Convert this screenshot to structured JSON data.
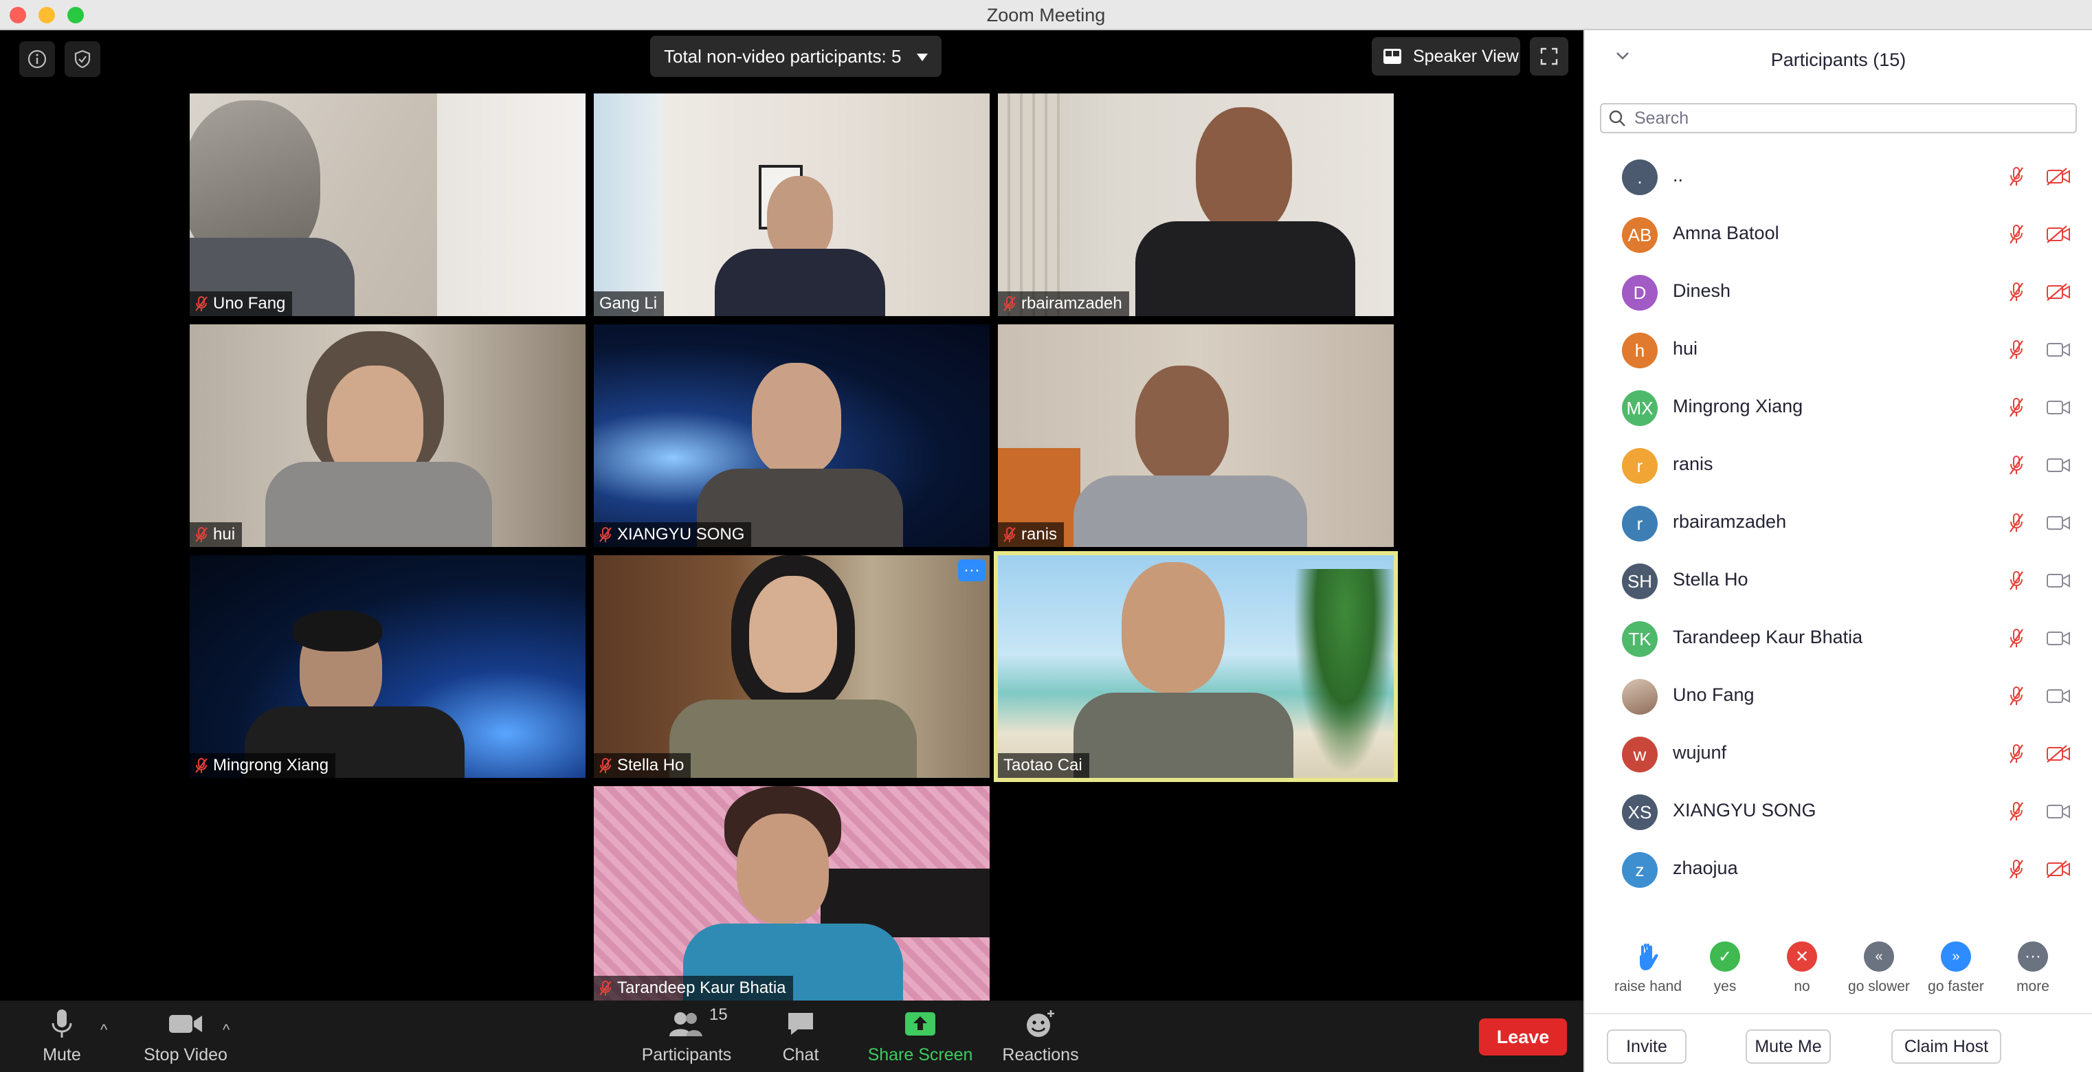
{
  "window": {
    "title": "Zoom Meeting"
  },
  "meeting": {
    "non_video_label": "Total non-video participants: 5",
    "speaker_view_label": "Speaker View"
  },
  "tiles": [
    {
      "name": "Uno Fang",
      "muted": true
    },
    {
      "name": "Gang Li",
      "muted": false
    },
    {
      "name": "rbairamzadeh",
      "muted": true
    },
    {
      "name": "hui",
      "muted": true
    },
    {
      "name": "XIANGYU SONG",
      "muted": true
    },
    {
      "name": "ranis",
      "muted": true
    },
    {
      "name": "Mingrong Xiang",
      "muted": true
    },
    {
      "name": "Stella Ho",
      "muted": true
    },
    {
      "name": "Taotao Cai",
      "muted": false,
      "active_speaker": true
    },
    {
      "name": "Tarandeep Kaur Bhatia",
      "muted": true
    }
  ],
  "toolbar": {
    "mute_label": "Mute",
    "stop_video_label": "Stop Video",
    "participants_label": "Participants",
    "participants_count": "15",
    "chat_label": "Chat",
    "share_screen_label": "Share Screen",
    "reactions_label": "Reactions",
    "leave_label": "Leave",
    "share_color": "#3fcb5f",
    "leave_color": "#e02828"
  },
  "panel": {
    "title": "Participants (15)",
    "search_placeholder": "Search",
    "participants": [
      {
        "initials": ".",
        "name": "..",
        "color": "#4b5a6e",
        "video": "off"
      },
      {
        "initials": "AB",
        "name": "Amna Batool",
        "color": "#e07a2e",
        "video": "off"
      },
      {
        "initials": "D",
        "name": "Dinesh",
        "color": "#a25ac4",
        "video": "off"
      },
      {
        "initials": "h",
        "name": "hui",
        "color": "#e07a2e",
        "video": "on"
      },
      {
        "initials": "MX",
        "name": "Mingrong Xiang",
        "color": "#4fb96b",
        "video": "on"
      },
      {
        "initials": "r",
        "name": "ranis",
        "color": "#f0a534",
        "video": "on"
      },
      {
        "initials": "r",
        "name": "rbairamzadeh",
        "color": "#3d7fb5",
        "video": "on"
      },
      {
        "initials": "SH",
        "name": "Stella Ho",
        "color": "#4b5a6e",
        "video": "on"
      },
      {
        "initials": "TK",
        "name": "Tarandeep Kaur Bhatia",
        "color": "#4fb96b",
        "video": "on"
      },
      {
        "initials": "",
        "name": "Uno Fang",
        "color": "#b89a86",
        "video": "on",
        "photo": true
      },
      {
        "initials": "w",
        "name": "wujunf",
        "color": "#c9473a",
        "video": "off"
      },
      {
        "initials": "XS",
        "name": "XIANGYU SONG",
        "color": "#4b5a6e",
        "video": "on"
      },
      {
        "initials": "z",
        "name": "zhaojua",
        "color": "#3d8fd0",
        "video": "off"
      }
    ],
    "reactions": [
      {
        "label": "raise hand",
        "icon": "raise-hand-icon",
        "color": "#2d8cff"
      },
      {
        "label": "yes",
        "icon": "check-icon",
        "color": "#3fb950"
      },
      {
        "label": "no",
        "icon": "x-icon",
        "color": "#e5413a"
      },
      {
        "label": "go slower",
        "icon": "rewind-icon",
        "color": "#6b7280"
      },
      {
        "label": "go faster",
        "icon": "fast-forward-icon",
        "color": "#2d8cff"
      },
      {
        "label": "more",
        "icon": "more-icon",
        "color": "#6b7280"
      }
    ],
    "invite_label": "Invite",
    "mute_me_label": "Mute Me",
    "claim_host_label": "Claim Host"
  }
}
